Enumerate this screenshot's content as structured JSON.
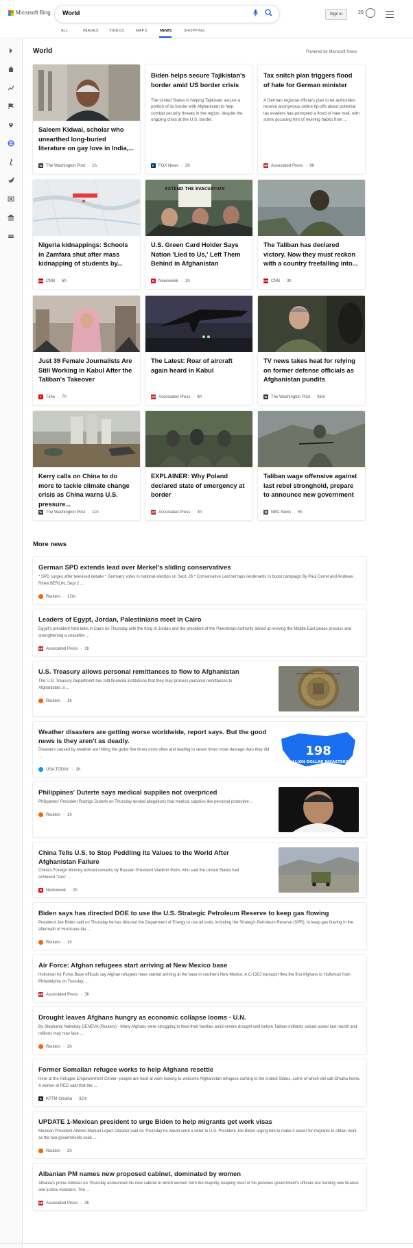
{
  "brand": {
    "name": "Microsoft Bing",
    "colors": [
      "#f25022",
      "#7fba00",
      "#00a4ef",
      "#ffb900"
    ]
  },
  "search": {
    "query": "World"
  },
  "header": {
    "signin": "Sign in",
    "rewards_points": "20"
  },
  "tabs": [
    "ALL",
    "IMAGES",
    "VIDEOS",
    "MAPS",
    "NEWS",
    "SHOPPING"
  ],
  "active_tab": "NEWS",
  "accent_color": "#174ae4",
  "sidebar_icons": [
    "chevron-right-icon",
    "home-icon",
    "trend-icon",
    "flag-icon",
    "location-icon",
    "globe-icon",
    "science-icon",
    "rocket-icon",
    "monitor-icon",
    "bank-icon",
    "wallet-icon"
  ],
  "world": {
    "title": "World",
    "powered_by": "Powered by Microsoft News",
    "cards": [
      {
        "title": "Saleem Kidwai, scholar who unearthed long-buried literature on gay love in India,...",
        "source": "The Washington Post",
        "time": "1h",
        "image": "portrait"
      },
      {
        "title": "Biden helps secure Tajikistan's border amid US border crisis",
        "snippet": "The United States is helping Tajikistan secure a portion of its border with Afghanistan to help combat security threats in the region, despite the ongoing crisis at the U.S. border.",
        "source": "FOX News",
        "time": "2h"
      },
      {
        "title": "Tax snitch plan triggers flood of hate for German minister",
        "snippet": "A German regional official's plan to let authorities receive anonymous online tip-offs about potential tax evaders has prompted a flood of hate mail, with some accusing him of reviving habits from ...",
        "source": "Associated Press",
        "time": "9h"
      },
      {
        "title": "Nigeria kidnappings: Schools in Zamfara shut after mass kidnapping of students by...",
        "source": "CNN",
        "time": "6h",
        "image": "map"
      },
      {
        "title": "U.S. Green Card Holder Says Nation 'Lied to Us,' Left Them Behind in Afghanistan",
        "source": "Newsweek",
        "time": "1h",
        "image": "protest",
        "image_text": "EXTEND THE EVACUATION"
      },
      {
        "title": "The Taliban has declared victory. Now they must reckon with a country freefalling into...",
        "source": "CNN",
        "time": "3h",
        "image": "soldier"
      },
      {
        "title": "Just 39 Female Journalists Are Still Working in Kabul After the Taliban's Takeover",
        "source": "Time",
        "time": "7h",
        "image": "woman"
      },
      {
        "title": "The Latest: Roar of aircraft again heard in Kabul",
        "source": "Associated Press",
        "time": "8h",
        "image": "aircraft"
      },
      {
        "title": "TV news takes heat for relying on former defense officials as Afghanistan pundits",
        "source": "The Washington Post",
        "time": "36m",
        "image": "general"
      },
      {
        "title": "Kerry calls on China to do more to tackle climate change crisis as China warns U.S. pressure...",
        "source": "The Washington Post",
        "time": "11h",
        "image": "flood"
      },
      {
        "title": "EXPLAINER: Why Poland declared state of emergency at border",
        "source": "Associated Press",
        "time": "3h",
        "image": "camp"
      },
      {
        "title": "Taliban wage offensive against last rebel stronghold, prepare to announce new government",
        "source": "NBC News",
        "time": "5h",
        "image": "fighter"
      }
    ]
  },
  "more_news": {
    "title": "More news",
    "items": [
      {
        "title": "German SPD extends lead over Merkel's sliding conservatives",
        "snippet": "* SPD surges after televised debate * Germany votes in national election on Sept. 26 * Conservative Laschet taps lieutenants to boost campaign By Paul Carrel and Andreas Rinke BERLIN, Sept 2 ...",
        "source": "Reuters",
        "time": "12m"
      },
      {
        "title": "Leaders of Egypt, Jordan, Palestinians meet in Cairo",
        "snippet": "Egypt's president held talks in Cairo on Thursday with the King of Jordan and the president of the Palestinian Authority aimed at reviving the Middle East peace process and strengthening a ceasefire ...",
        "source": "Associated Press",
        "time": "2h"
      },
      {
        "title": "U.S. Treasury allows personal remittances to flow to Afghanistan",
        "snippet": "The U.S. Treasury Department has told financial institutions that they may process personal remittances to Afghanistan, a ...",
        "source": "Reuters",
        "time": "1h",
        "thumb": "seal",
        "thumb_text": "THE DEPARTMENT OF THE TREASURY 1789"
      },
      {
        "title": "Weather disasters are getting worse worldwide, report says. But the good news is they aren't as deadly.",
        "snippet": "Disasters caused by weather are hitting the globe five times more often and leading to seven times more damage than they did ...",
        "source": "USA TODAY",
        "time": "2h",
        "thumb": "usmap",
        "thumb_big": "198",
        "thumb_text": "BILLION DOLLAR DISASTERS"
      },
      {
        "title": "Philippines' Duterte says medical supplies not overpriced",
        "snippet": "Philippines' President Rodrigo Duterte on Thursday denied allegations that medical supplies like personal protective ...",
        "source": "Reuters",
        "time": "1h",
        "thumb": "portrait-dark"
      },
      {
        "title": "China Tells U.S. to Stop Peddling Its Values to the World After Afghanistan Failure",
        "snippet": "China's Foreign Ministry echoed remarks by Russian President Vladimir Putin, who said the United States had achieved \"zero\" ...",
        "source": "Newsweek",
        "time": "2h",
        "thumb": "runway"
      },
      {
        "title": "Biden says has directed DOE to use the U.S. Strategic Petroleum Reserve to keep gas flowing",
        "snippet": "President Joe Biden said on Thursday he has directed the Department of Energy to use all tools, including the Strategic Petroleum Reserve (SPR), to keep gas flowing in the aftermath of Hurricane Ida ...",
        "source": "Reuters",
        "time": "1h"
      },
      {
        "title": "Air Force: Afghan refugees start arriving at New Mexico base",
        "snippet": "Holloman Air Force Base officials say Afghan refugees have started arriving at the base in southern New Mexico. A C-130J transport flew the first Afghans to Holloman from Philadelphia on Tuesday, ...",
        "source": "Associated Press",
        "time": "3h"
      },
      {
        "title": "Drought leaves Afghans hungry as economic collapse looms - U.N.",
        "snippet": "By Stephanie Nebehay GENEVA (Reuters) - Many Afghans were struggling to feed their families amid severe drought well before Taliban militants seized power last month and millions may now face ...",
        "source": "Reuters",
        "time": "2h"
      },
      {
        "title": "Former Somalian refugee works to help Afghans resettle",
        "snippet": "Here at the Refugee Empowerment Center--people are hard at work looking to welcome Afghanistan refugees coming to the United States, some of which will call Omaha home. A worker at REC said that the ...",
        "source": "KPTM Omaha",
        "time": "32m"
      },
      {
        "title": "UPDATE 1-Mexican president to urge Biden to help migrants get work visas",
        "snippet": "Mexican President Andres Manuel Lopez Obrador said on Thursday he would send a letter to U.S. President Joe Biden urging him to make it easier for migrants to obtain work as the two governments seek ...",
        "source": "Reuters",
        "time": "2h"
      },
      {
        "title": "Albanian PM names new proposed cabinet, dominated by women",
        "snippet": "Albania's prime minister on Thursday announced his new cabinet in which women form the majority, keeping most of his previous government's officials but naming new finance and justice ministers. The ...",
        "source": "Associated Press",
        "time": "3h"
      }
    ]
  }
}
